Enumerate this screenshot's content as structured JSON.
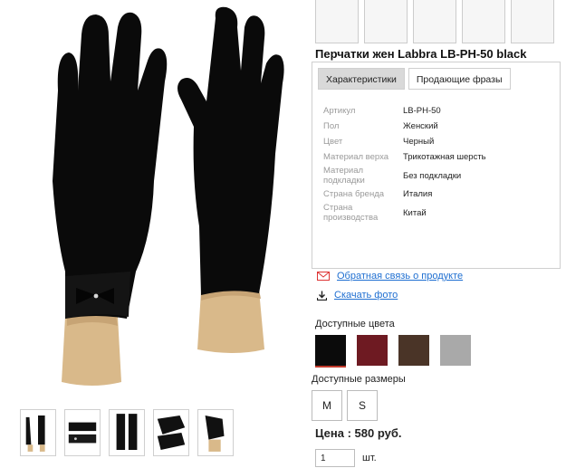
{
  "product": {
    "title": "Перчатки жен Labbra LB-PH-50 black"
  },
  "tabs": [
    {
      "label": "Характеристики",
      "active": true
    },
    {
      "label": "Продающие фразы",
      "active": false
    }
  ],
  "specs": [
    {
      "label": "Артикул",
      "value": "LB-PH-50"
    },
    {
      "label": "Пол",
      "value": "Женский"
    },
    {
      "label": "Цвет",
      "value": "Черный"
    },
    {
      "label": "Материал верха",
      "value": "Трикотажная шерсть"
    },
    {
      "label": "Материал подкладки",
      "value": "Без подкладки"
    },
    {
      "label": "Страна бренда",
      "value": "Италия"
    },
    {
      "label": "Страна производства",
      "value": "Китай"
    }
  ],
  "links": {
    "feedback": "Обратная связь о продукте",
    "download": "Скачать фото"
  },
  "colors": {
    "label": "Доступные цвета",
    "swatches": [
      "#0b0b0b",
      "#6e1a22",
      "#4a3427",
      "#a9a9a9"
    ],
    "selected_accent": "#c0392b"
  },
  "sizes": {
    "label": "Доступные размеры",
    "options": [
      "M",
      "S"
    ]
  },
  "price": {
    "text": "Цена : 580 руб."
  },
  "quantity": {
    "value": "1",
    "unit": "шт."
  },
  "icons": {
    "feedback": "mail-icon",
    "download": "download-icon"
  },
  "accent_color": "#1f6fd1"
}
